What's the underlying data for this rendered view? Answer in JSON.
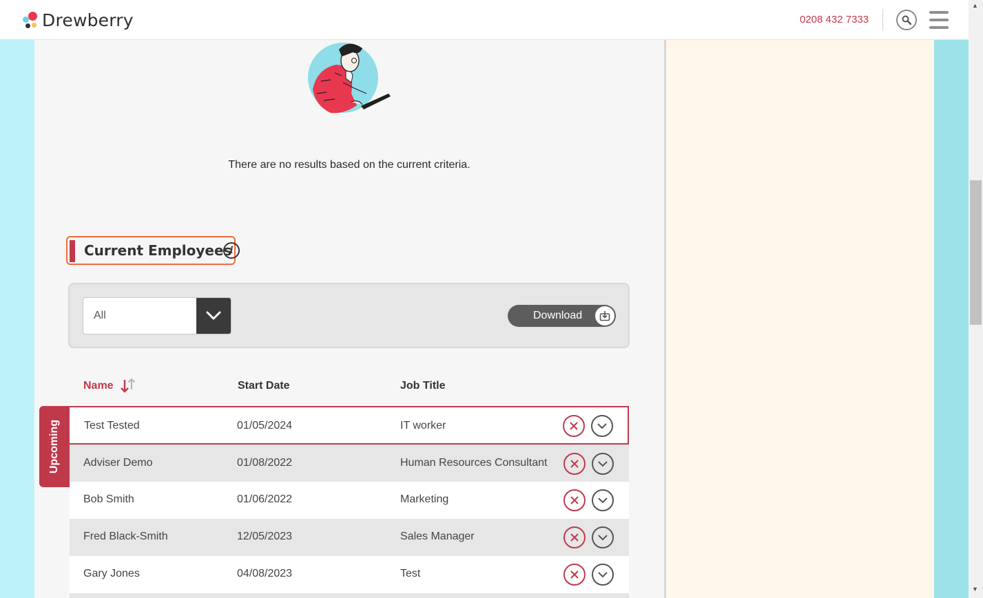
{
  "header": {
    "brand": "Drewberry",
    "phone": "0208 432 7333"
  },
  "empty_state": {
    "message": "There are no results based on the current criteria."
  },
  "section": {
    "title": "Current Employees",
    "info_glyph": "i"
  },
  "filter": {
    "selected": "All",
    "download_label": "Download"
  },
  "table": {
    "columns": [
      "Name",
      "Start Date",
      "Job Title"
    ],
    "upcoming_label": "Upcoming",
    "rows": [
      {
        "name": "Test Tested",
        "start_date": "01/05/2024",
        "job_title": "IT worker"
      },
      {
        "name": "Adviser Demo",
        "start_date": "01/08/2022",
        "job_title": "Human Resources Consultant"
      },
      {
        "name": "Bob Smith",
        "start_date": "01/06/2022",
        "job_title": "Marketing"
      },
      {
        "name": "Fred Black-Smith",
        "start_date": "12/05/2023",
        "job_title": "Sales Manager"
      },
      {
        "name": "Gary Jones",
        "start_date": "04/08/2023",
        "job_title": "Test"
      }
    ]
  },
  "colors": {
    "accent": "#c0394b",
    "highlight_border": "#f26b3a",
    "main_bg": "#f6f6f6",
    "aside_bg": "#fef7ea",
    "page_bg": "#bdf3f8"
  },
  "icons": [
    "search-icon",
    "hamburger-menu-icon",
    "info-icon",
    "chevron-down-icon",
    "download-icon",
    "sort-icon",
    "remove-icon",
    "expand-icon"
  ]
}
